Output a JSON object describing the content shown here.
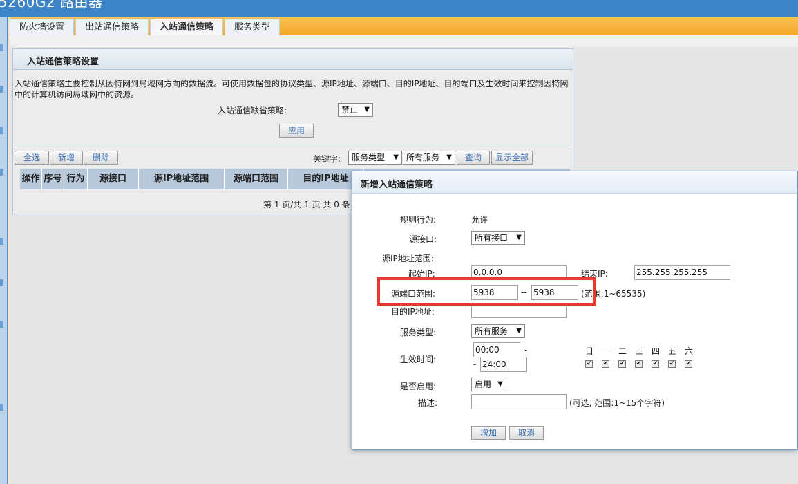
{
  "header": {
    "title": "5260G2 路由器"
  },
  "tabs": [
    "防火墙设置",
    "出站通信策略",
    "入站通信策略",
    "服务类型"
  ],
  "panel": {
    "title": "入站通信策略设置",
    "description": "入站通信策略主要控制从因特网到局域网方向的数据流。可使用数据包的协议类型、源IP地址、源端口、目的IP地址、目的端口及生效时间来控制因特网中的计算机访问局域网中的资源。",
    "default_policy_label": "入站通信缺省策略:",
    "default_policy_value": "禁止",
    "apply_button": "应用",
    "select_all_button": "全选",
    "add_button": "新增",
    "delete_button": "删除",
    "keyword_label": "关键字:",
    "keyword_field": "服务类型",
    "keyword_value": "所有服务",
    "search_button": "查询",
    "show_all_button": "显示全部",
    "columns": [
      "操作",
      "序号",
      "行为",
      "源接口",
      "源IP地址范围",
      "源端口范围",
      "目的IP地址"
    ],
    "pager": "第 1 页/共 1 页 共 0 条"
  },
  "dialog": {
    "title": "新增入站通信策略",
    "rule_action_label": "规则行为:",
    "rule_action_value": "允许",
    "src_interface_label": "源接口:",
    "src_interface_value": "所有接口",
    "src_ip_range_label": "源IP地址范围:",
    "start_ip_label": "起始IP:",
    "start_ip_value": "0.0.0.0",
    "end_ip_label": "结束IP:",
    "end_ip_value": "255.255.255.255",
    "src_port_label": "源端口范围:",
    "src_port_start": "5938",
    "src_port_sep": "--",
    "src_port_end": "5938",
    "src_port_hint": "(范围:1~65535)",
    "dst_ip_label": "目的IP地址:",
    "dst_ip_value": "",
    "service_label": "服务类型:",
    "service_value": "所有服务",
    "time_label": "生效时间:",
    "time_start": "00:00",
    "time_dash1": "-",
    "time_dash2": "-",
    "time_end": "24:00",
    "weekdays": [
      "日",
      "一",
      "二",
      "三",
      "四",
      "五",
      "六"
    ],
    "enable_label": "是否启用:",
    "enable_value": "启用",
    "desc_label": "描述:",
    "desc_value": "",
    "desc_hint": "(可选, 范围:1~15个字符)",
    "add_button": "增加",
    "cancel_button": "取消"
  },
  "accent_colors": {
    "header": "#3c83c8",
    "tabs_bar": "#f5a623",
    "highlight": "#e53935"
  }
}
